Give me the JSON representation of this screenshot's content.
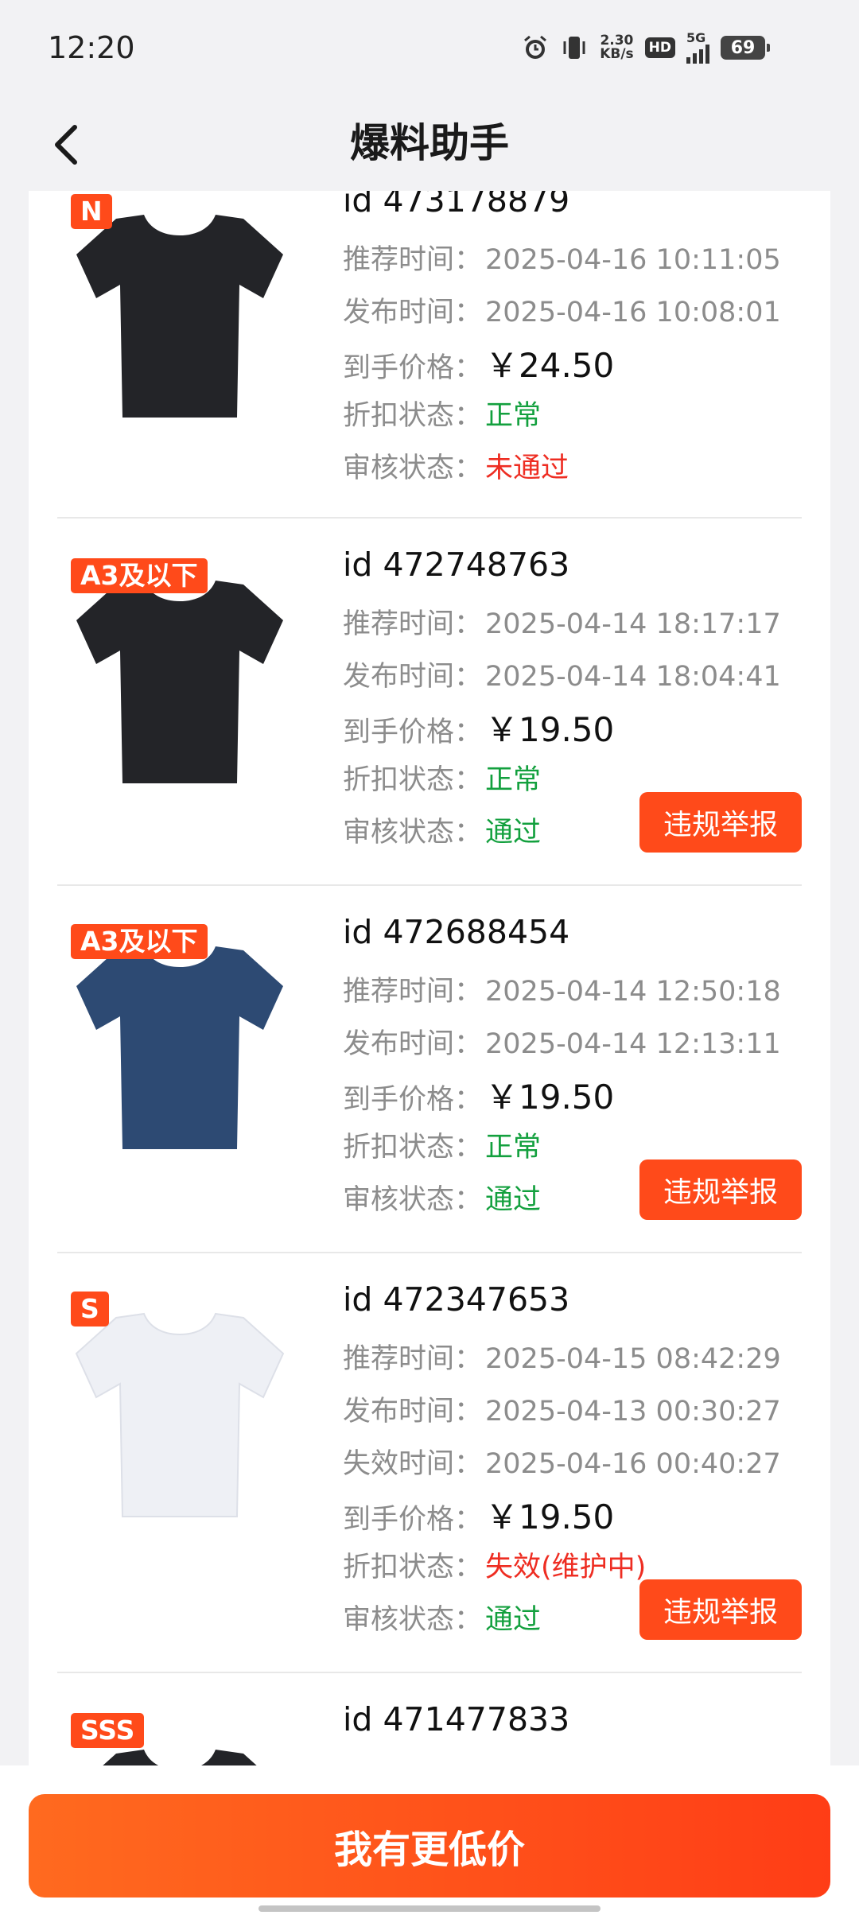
{
  "status_bar": {
    "time": "12:20",
    "net_speed_value": "2.30",
    "net_speed_unit": "KB/s",
    "hd_label": "HD",
    "network_label": "5G",
    "battery": "69"
  },
  "header": {
    "title": "爆料助手"
  },
  "labels": {
    "recommend_time": "推荐时间：",
    "publish_time": "发布时间：",
    "expire_time": "失效时间：",
    "final_price": "到手价格：",
    "discount_status": "折扣状态：",
    "review_status": "审核状态：",
    "report_button": "违规举报"
  },
  "items": [
    {
      "badge": "N",
      "id_text": "id 473178879",
      "recommend_time": "2025-04-16 10:11:05",
      "publish_time": "2025-04-16 10:08:01",
      "price": "￥24.50",
      "discount_status": "正常",
      "review_status": "未通过",
      "shirt_color": "#232428"
    },
    {
      "badge": "A3及以下",
      "id_text": "id 472748763",
      "recommend_time": "2025-04-14 18:17:17",
      "publish_time": "2025-04-14 18:04:41",
      "price": "￥19.50",
      "discount_status": "正常",
      "review_status": "通过",
      "shirt_color": "#232428"
    },
    {
      "badge": "A3及以下",
      "id_text": "id 472688454",
      "recommend_time": "2025-04-14 12:50:18",
      "publish_time": "2025-04-14 12:13:11",
      "price": "￥19.50",
      "discount_status": "正常",
      "review_status": "通过",
      "shirt_color": "#2d4a73"
    },
    {
      "badge": "S",
      "id_text": "id 472347653",
      "recommend_time": "2025-04-15 08:42:29",
      "publish_time": "2025-04-13 00:30:27",
      "expire_time": "2025-04-16 00:40:27",
      "price": "￥19.50",
      "discount_status": "失效(维护中)",
      "review_status": "通过",
      "shirt_color": "#eef0f5"
    },
    {
      "badge": "SSS",
      "id_text": "id 471477833",
      "shirt_color": "#232428"
    }
  ],
  "footer": {
    "button_label": "我有更低价"
  },
  "colors": {
    "accent": "#ff4a1a",
    "status_ok": "#13a03e",
    "status_bad": "#ee2d22"
  }
}
